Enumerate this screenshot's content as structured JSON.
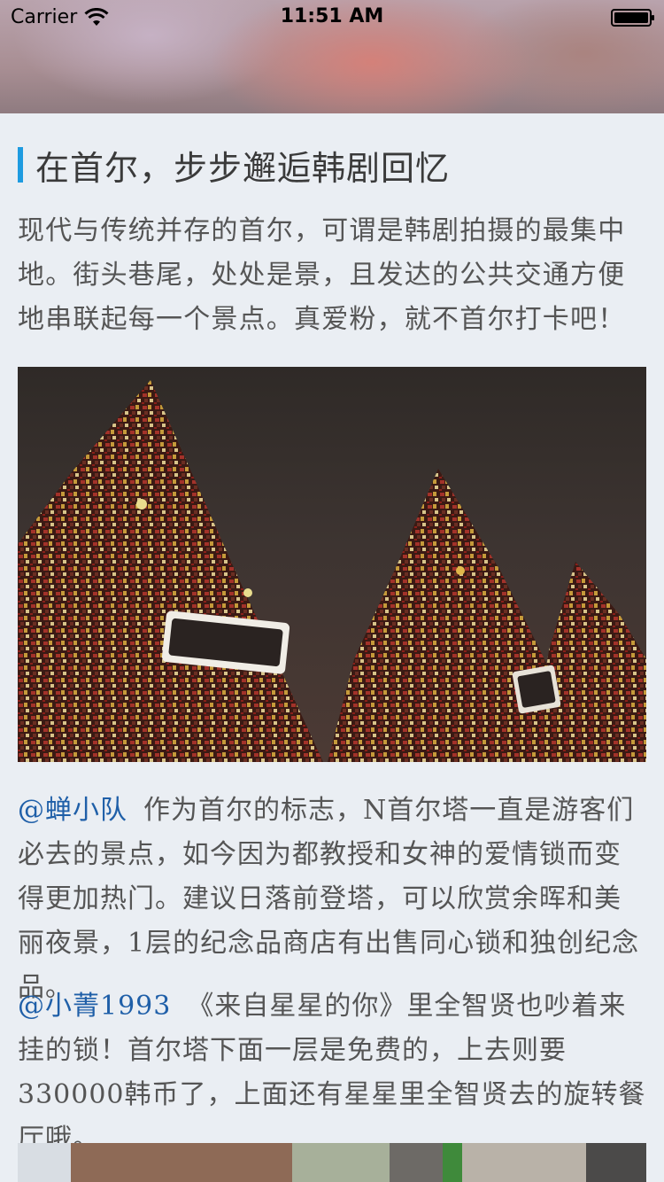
{
  "status_bar": {
    "carrier": "Carrier",
    "time": "11:51 AM"
  },
  "article": {
    "title": "在首尔，步步邂逅韩剧回忆",
    "intro": "现代与传统并存的首尔，可谓是韩剧拍摄的最集中地。街头巷尾，处处是景，且发达的公共交通方便地串联起每一个景点。真爱粉，就不首尔打卡吧！",
    "comments": [
      {
        "user": "@蝉小队",
        "text": "作为首尔的标志，N首尔塔一直是游客们必去的景点，如今因为都教授和女神的爱情锁而变得更加热门。建议日落前登塔，可以欣赏余晖和美丽夜景，1层的纪念品商店有出售同心锁和独创纪念品。"
      },
      {
        "user": "@小菁1993",
        "text": "《来自星星的你》里全智贤也吵着来挂的锁！首尔塔下面一层是免费的，上去则要330000韩币了，上面还有星星里全智贤去的旋转餐厅哦。"
      }
    ]
  },
  "colors": {
    "accent_bar": "#1e9be0",
    "user_handle": "#1f5fa8",
    "body_text": "#555555",
    "background": "#eaeef3"
  },
  "icons": {
    "wifi": "wifi-icon",
    "battery": "battery-icon"
  }
}
